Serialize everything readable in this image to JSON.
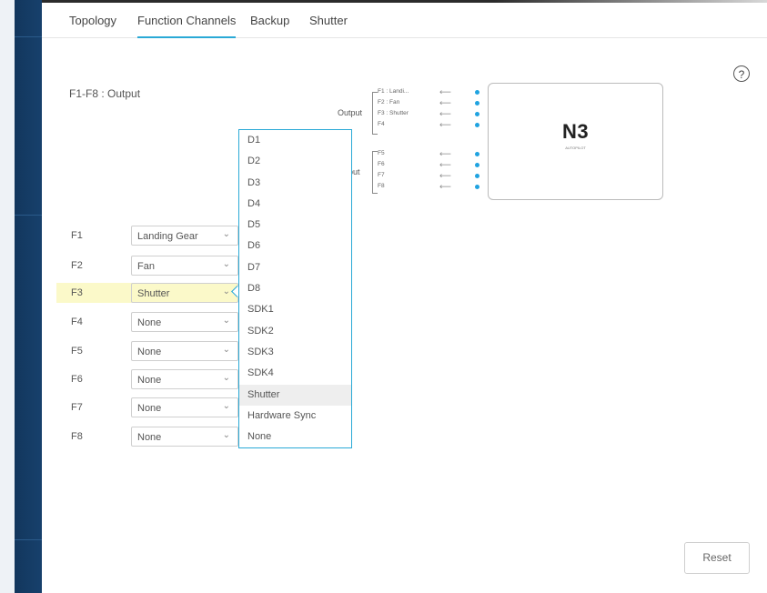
{
  "tabs": [
    {
      "label": "Topology"
    },
    {
      "label": "Function Channels",
      "active": true
    },
    {
      "label": "Backup"
    },
    {
      "label": "Shutter"
    }
  ],
  "help_icon": "question-circle-icon",
  "section_title": "F1-F8 : Output",
  "diagram": {
    "output_label_1": "Output",
    "output_label_2": "put",
    "channels": [
      {
        "label": "F1 : Landi..."
      },
      {
        "label": "F2 : Fan"
      },
      {
        "label": "F3 : Shutter"
      },
      {
        "label": "F4"
      },
      {
        "label": "F5"
      },
      {
        "label": "F6"
      },
      {
        "label": "F7"
      },
      {
        "label": "F8"
      }
    ],
    "arrow": "⟵",
    "device_logo": "N3",
    "device_sub": "AUTOPILOT"
  },
  "rows": [
    {
      "fn": "F1",
      "value": "Landing Gear"
    },
    {
      "fn": "F2",
      "value": "Fan"
    },
    {
      "fn": "F3",
      "value": "Shutter",
      "highlight": true
    },
    {
      "fn": "F4",
      "value": "None"
    },
    {
      "fn": "F5",
      "value": "None"
    },
    {
      "fn": "F6",
      "value": "None"
    },
    {
      "fn": "F7",
      "value": "None"
    },
    {
      "fn": "F8",
      "value": "None"
    }
  ],
  "chevron": "⌄",
  "dropdown": {
    "items": [
      "D1",
      "D2",
      "D3",
      "D4",
      "D5",
      "D6",
      "D7",
      "D8",
      "SDK1",
      "SDK2",
      "SDK3",
      "SDK4",
      "Shutter",
      "Hardware Sync",
      "None"
    ],
    "selected": "Shutter"
  },
  "reset_label": "Reset",
  "colors": {
    "accent": "#2aa9d6",
    "highlight": "#fbf9c9",
    "dot": "#1fa3e0"
  }
}
